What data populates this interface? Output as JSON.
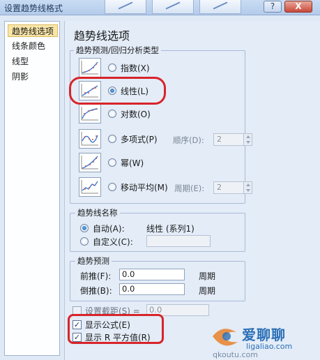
{
  "window": {
    "title": "设置趋势线格式",
    "help_label": "?",
    "close_label": "X"
  },
  "sidebar": {
    "items": [
      {
        "label": "趋势线选项",
        "selected": true
      },
      {
        "label": "线条颜色",
        "selected": false
      },
      {
        "label": "线型",
        "selected": false
      },
      {
        "label": "阴影",
        "selected": false
      }
    ]
  },
  "panel": {
    "heading": "趋势线选项",
    "type_group": {
      "label": "趋势预测/回归分析类型",
      "options": [
        {
          "label": "指数(X)",
          "icon": "exponential-trend-icon",
          "selected": false
        },
        {
          "label": "线性(L)",
          "icon": "linear-trend-icon",
          "selected": true
        },
        {
          "label": "对数(O)",
          "icon": "logarithmic-trend-icon",
          "selected": false
        },
        {
          "label": "多项式(P)",
          "icon": "polynomial-trend-icon",
          "selected": false
        },
        {
          "label": "幂(W)",
          "icon": "power-trend-icon",
          "selected": false
        },
        {
          "label": "移动平均(M)",
          "icon": "moving-average-icon",
          "selected": false
        }
      ],
      "order_label": "顺序(D):",
      "order_value": "2",
      "period_label": "周期(E):",
      "period_value": "2"
    },
    "name_group": {
      "label": "趋势线名称",
      "auto_label": "自动(A):",
      "auto_value": "线性 (系列1)",
      "custom_label": "自定义(C):",
      "custom_value": ""
    },
    "forecast_group": {
      "label": "趋势预测",
      "forward_label": "前推(F):",
      "forward_value": "0.0",
      "forward_unit": "周期",
      "backward_label": "倒推(B):",
      "backward_value": "0.0",
      "backward_unit": "周期"
    },
    "intercept": {
      "label": "设置截距(S) =",
      "value": "0.0",
      "checked": false
    },
    "show_equation": {
      "label": "显示公式(E)",
      "checked": true
    },
    "show_r_squared": {
      "label": "显示 R 平方值(R)",
      "checked": true
    }
  },
  "watermark": {
    "brand": "爱聊聊",
    "url": "ligaliao.com",
    "url2": "qkoutu.com"
  },
  "colors": {
    "highlight_oval": "#d8242a",
    "selected_nav": "#f9e6a8",
    "accent": "#1d5fa8"
  }
}
